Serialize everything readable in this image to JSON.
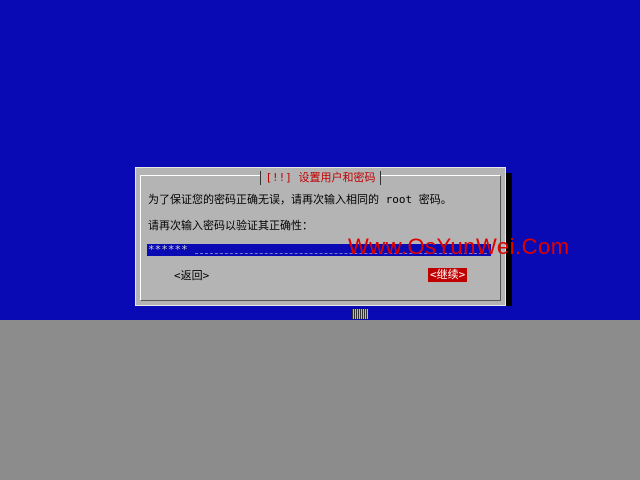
{
  "dialog": {
    "title": "[!!] 设置用户和密码",
    "message_line1": "为了保证您的密码正确无误，请再次输入相同的 root 密码。",
    "message_line2": "请再次输入密码以验证其正确性：",
    "password_value": "******",
    "back_label": "<返回>",
    "continue_label": "<继续>"
  },
  "watermark": {
    "text": "Www.OsYunWei.Com"
  },
  "colors": {
    "background": "#0a0ab4",
    "dialog": "#b4b4b4",
    "accent": "#c00000",
    "lower_panel": "#8c8c8c"
  }
}
